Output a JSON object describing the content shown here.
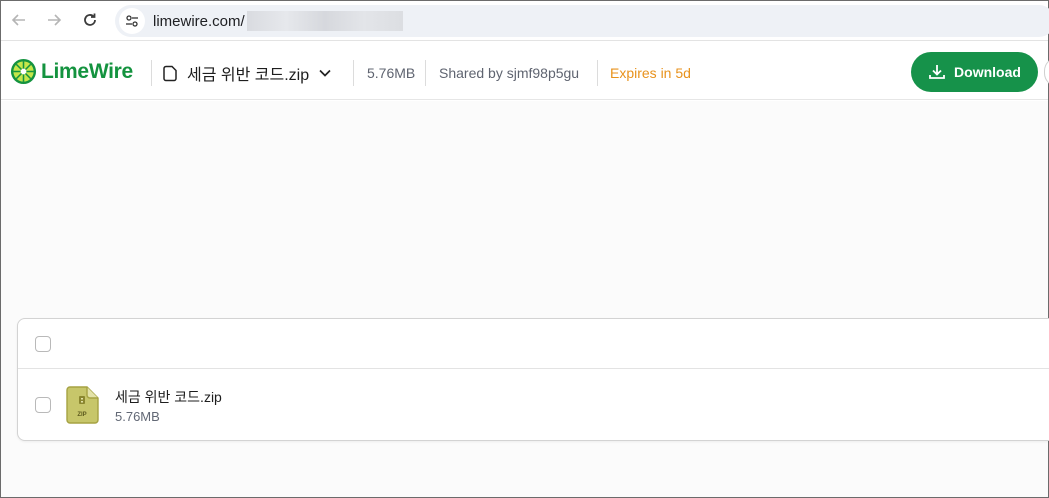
{
  "browser": {
    "url": "limewire.com/",
    "back_icon": "arrow-left-icon",
    "forward_icon": "arrow-right-icon",
    "reload_icon": "reload-icon",
    "site_info_icon": "tune-icon"
  },
  "header": {
    "brand": "LimeWire",
    "brand_color": "#14933f",
    "file_name": "세금 위반 코드.zip",
    "file_size": "5.76MB",
    "shared_by": "Shared by sjmf98p5gu",
    "expires": "Expires in 5d",
    "expires_color": "#e8921c",
    "download_label": "Download",
    "download_color": "#16924a"
  },
  "files": {
    "rows": [
      {
        "name": "세금 위반 코드.zip",
        "size": "5.76MB",
        "icon": "zip-file-icon",
        "icon_label": "ZIP"
      }
    ]
  }
}
